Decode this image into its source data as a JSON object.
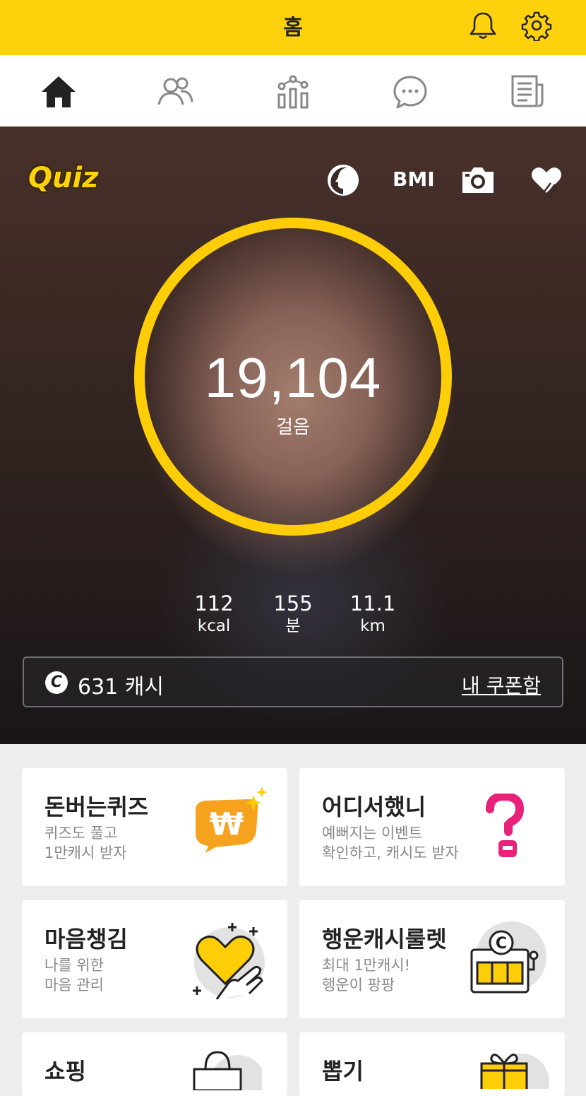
{
  "header": {
    "title": "홈",
    "bell_icon": "bell-icon",
    "settings_icon": "gear-icon",
    "accent": "#fdd20d"
  },
  "tabs": [
    {
      "icon": "home-icon",
      "active": true
    },
    {
      "icon": "friends-icon"
    },
    {
      "icon": "stats-icon"
    },
    {
      "icon": "chat-icon"
    },
    {
      "icon": "news-icon"
    }
  ],
  "hero": {
    "quiz_label": "Quiz",
    "bmi_label": "BMI",
    "steps": "19,104",
    "steps_unit": "걸음",
    "progress": 1.0,
    "stats": [
      {
        "value": "112",
        "unit": "kcal"
      },
      {
        "value": "155",
        "unit": "분"
      },
      {
        "value": "11.1",
        "unit": "km"
      }
    ],
    "cash_symbol": "C",
    "cash": "631 캐시",
    "coupon_link": "내 쿠폰함"
  },
  "cards": [
    {
      "title": "돈버는퀴즈",
      "line1": "퀴즈도 풀고",
      "line2": "1만캐시 받자",
      "icon": "won-coin-icon"
    },
    {
      "title": "어디서했니",
      "line1": "예뻐지는 이벤트",
      "line2": "확인하고, 캐시도 받자",
      "icon": "question-mark-icon"
    },
    {
      "title": "마음챙김",
      "line1": "나를 위한",
      "line2": "마음 관리",
      "icon": "heart-hand-icon"
    },
    {
      "title": "행운캐시룰렛",
      "line1": "최대 1만캐시!",
      "line2": "행운이 팡팡",
      "icon": "slot-machine-icon",
      "coin_symbol": "C"
    },
    {
      "title": "쇼핑",
      "line1": "",
      "line2": "",
      "icon": "shopping-bag-icon"
    },
    {
      "title": "뽑기",
      "line1": "",
      "line2": "",
      "icon": "gift-box-icon"
    }
  ]
}
